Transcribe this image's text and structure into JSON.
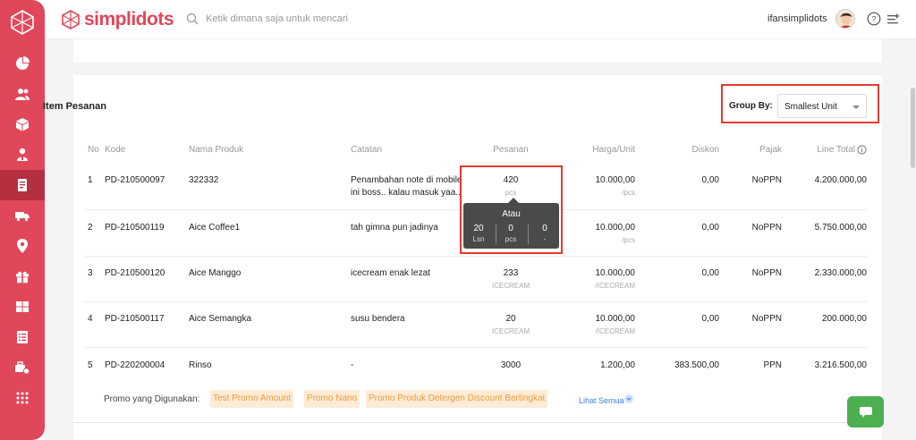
{
  "app": {
    "brand": "simplidots"
  },
  "sidebar": {
    "items": [
      {
        "icon": "dashboard-pie-icon"
      },
      {
        "icon": "users-icon"
      },
      {
        "icon": "box-icon"
      },
      {
        "icon": "salesman-icon"
      },
      {
        "icon": "order-document-icon",
        "active": true
      },
      {
        "icon": "delivery-truck-icon"
      },
      {
        "icon": "location-pin-icon"
      },
      {
        "icon": "gift-icon"
      },
      {
        "icon": "warehouse-icon"
      },
      {
        "icon": "report-list-icon"
      },
      {
        "icon": "cart-settings-icon"
      },
      {
        "icon": "apps-grid-icon"
      }
    ]
  },
  "header": {
    "search_placeholder": "Ketik dimana saja untuk mencari",
    "username": "ifansimplidots"
  },
  "section": {
    "title": "Item Pesanan"
  },
  "group_by": {
    "label": "Group By:",
    "selected": "Smallest Unit"
  },
  "table": {
    "headers": {
      "no": "No",
      "kode": "Kode",
      "nama": "Nama Produk",
      "catatan": "Catatan",
      "pesanan": "Pesanan",
      "harga": "Harga/Unit",
      "diskon": "Diskon",
      "pajak": "Pajak",
      "total": "Line Total"
    },
    "rows": [
      {
        "no": "1",
        "kode": "PD-210500097",
        "nama": "322332",
        "catatan_1": "Penambahan note di mobile",
        "catatan_2": "ini boss.. kalau masuk yaa..",
        "qty": "420",
        "qty_unit": "pcs",
        "harga": "10.000,00",
        "harga_unit": "/pcs",
        "diskon": "0,00",
        "pajak": "NoPPN",
        "total": "4.200.000,00"
      },
      {
        "no": "2",
        "kode": "PD-210500119",
        "nama": "Aice Coffee1",
        "catatan_1": "tah gimna pun jadinya",
        "catatan_2": "",
        "qty": "",
        "qty_unit": "",
        "harga": "10.000,00",
        "harga_unit": "/pcs",
        "diskon": "0,00",
        "pajak": "NoPPN",
        "total": "5.750.000,00"
      },
      {
        "no": "3",
        "kode": "PD-210500120",
        "nama": "Aice Manggo",
        "catatan_1": "icecream enak lezat",
        "catatan_2": "",
        "qty": "233",
        "qty_unit": "ICECREAM",
        "harga": "10.000,00",
        "harga_unit": "/ICECREAM",
        "diskon": "0,00",
        "pajak": "NoPPN",
        "total": "2.330.000,00"
      },
      {
        "no": "4",
        "kode": "PD-210500117",
        "nama": "Aice Semangka",
        "catatan_1": "susu bendera",
        "catatan_2": "",
        "qty": "20",
        "qty_unit": "ICECREAM",
        "harga": "10.000,00",
        "harga_unit": "/ICECREAM",
        "diskon": "0,00",
        "pajak": "NoPPN",
        "total": "200.000,00"
      },
      {
        "no": "5",
        "kode": "PD-220200004",
        "nama": "Rinso",
        "catatan_1": "-",
        "catatan_2": "",
        "qty": "3000",
        "qty_unit": "",
        "harga": "1.200,00",
        "harga_unit": "",
        "diskon": "383.500,00",
        "pajak": "PPN",
        "total": "3.216.500,00"
      }
    ]
  },
  "tooltip": {
    "title": "Atau",
    "cols": [
      {
        "value": "20",
        "unit": "Lsn"
      },
      {
        "value": "0",
        "unit": "pcs"
      },
      {
        "value": "0",
        "unit": "-"
      }
    ]
  },
  "promo": {
    "label": "Promo yang Digunakan:",
    "chips": [
      "Test Promo Amount",
      "Promo Nano",
      "Promo Produk Detergen Discount Bertingkat"
    ],
    "see_all": "Lihat Semua"
  },
  "colors": {
    "brand": "#e0475a",
    "highlight": "#e53a2e",
    "promo_bg": "#fdebd5",
    "promo_text": "#ef9b3b",
    "chat": "#4caf50"
  }
}
